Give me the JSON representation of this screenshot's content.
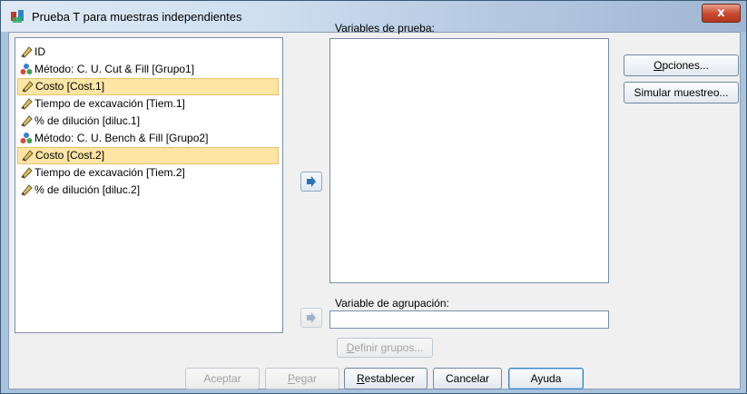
{
  "window": {
    "title": "Prueba T para muestras independientes",
    "close_symbol": "x",
    "accent_color": "#3d7bbf"
  },
  "source_variables": [
    {
      "label": "ID",
      "icon": "scale-icon",
      "selected": false
    },
    {
      "label": "Método: C. U. Cut & Fill [Grupo1]",
      "icon": "nominal-icon",
      "selected": false
    },
    {
      "label": "Costo [Cost.1]",
      "icon": "scale-icon",
      "selected": true
    },
    {
      "label": "Tiempo de excavación [Tiem.1]",
      "icon": "scale-icon",
      "selected": false
    },
    {
      "label": "% de dilución [diluc.1]",
      "icon": "scale-icon",
      "selected": false
    },
    {
      "label": "Método: C. U. Bench & Fill [Grupo2]",
      "icon": "nominal-icon",
      "selected": false
    },
    {
      "label": "Costo [Cost.2]",
      "icon": "scale-icon",
      "selected": true
    },
    {
      "label": "Tiempo de excavación [Tiem.2]",
      "icon": "scale-icon",
      "selected": false
    },
    {
      "label": "% de dilución [diluc.2]",
      "icon": "scale-icon",
      "selected": false
    }
  ],
  "test_variables": {
    "label": "Variables de prueba:",
    "items": []
  },
  "grouping": {
    "label": "Variable de agrupación:",
    "value": "",
    "define_groups_label": "Definir grupos..."
  },
  "side_buttons": {
    "options_label": "Opciones...",
    "bootstrap_label": "Simular muestreo..."
  },
  "bottom_buttons": {
    "ok_label": "Aceptar",
    "paste_label": "Pegar",
    "reset_label": "Restablecer",
    "cancel_label": "Cancelar",
    "help_label": "Ayuda"
  }
}
